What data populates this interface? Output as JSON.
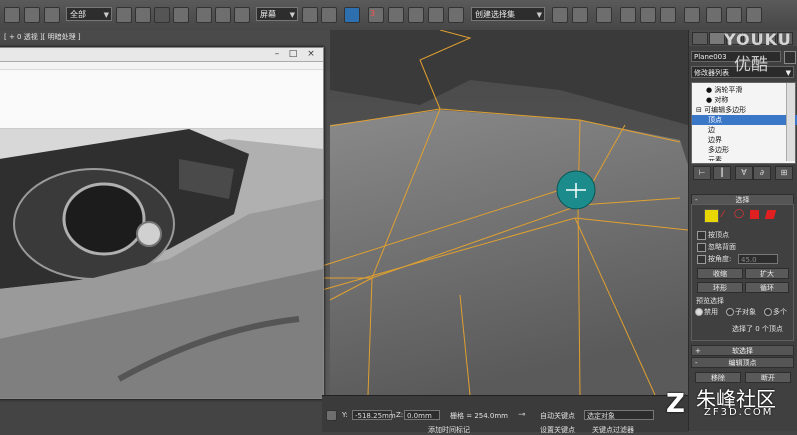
{
  "toolbar": {
    "selection_filter": "全部",
    "ref_coord": "屏幕",
    "named_selection": "创建选择集",
    "snap_label": "3"
  },
  "viewport": {
    "label": "[ + 0 透视 ][ 明暗处理 ]"
  },
  "photo_window": {
    "title": ""
  },
  "panel": {
    "object_name": "Plane003",
    "modifier_list": "修改器列表",
    "stack": [
      "涡轮平滑",
      "对称",
      "可编辑多边形",
      "顶点",
      "边",
      "边界",
      "多边形",
      "元素"
    ],
    "selected_index": 3
  },
  "selection": {
    "header": "选择",
    "by_vertex": "按顶点",
    "ignore_backface": "忽略背面",
    "by_angle": "按角度:",
    "angle_value": "45.0",
    "shrink": "收缩",
    "grow": "扩大",
    "ring": "环形",
    "loop": "循环",
    "preview_label": "预览选择",
    "preview_opts": [
      "禁用",
      "子对象",
      "多个"
    ],
    "status": "选择了 0 个顶点"
  },
  "soft_selection": {
    "header": "软选择"
  },
  "edit_vertices": {
    "header": "编辑顶点",
    "remove": "移除",
    "break": "断开"
  },
  "status_bar": {
    "y_label": "Y:",
    "y_value": "-518.25mm",
    "z_label": "Z:",
    "z_value": "0.0mm",
    "grid": "栅格 = 254.0mm",
    "autokey": "自动关键点",
    "selected_obj": "选定对象",
    "setkey": "设置关键点",
    "keyfilter": "关键点过滤器",
    "add_time_tag": "添加时间标记"
  },
  "watermarks": {
    "youku1": "YOUKU",
    "youku2": "优酷",
    "zf_brand": "朱峰社区",
    "zf_url": "ZF3D.COM"
  },
  "colors": {
    "vertex_marker": "#1b8b8c",
    "edge": "#e0a030",
    "selection_blue": "#3b77c7"
  }
}
